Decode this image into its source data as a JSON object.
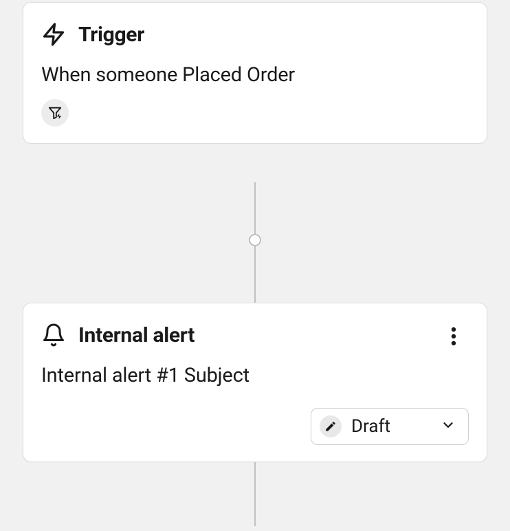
{
  "trigger": {
    "title": "Trigger",
    "description": "When someone Placed Order"
  },
  "alert": {
    "title": "Internal alert",
    "subject": "Internal alert #1 Subject",
    "status": {
      "label": "Draft"
    }
  }
}
